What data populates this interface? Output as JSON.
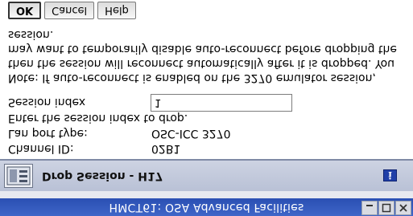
{
  "window": {
    "title": "HMCT61: OSA Advanced Facilities",
    "controls": [
      "minimize",
      "maximize",
      "close"
    ]
  },
  "dialog": {
    "title": "Drop Session - H17",
    "help_icon": "info-icon"
  },
  "fields": {
    "channel_id": {
      "label": "Channel ID:",
      "value": "02B1"
    },
    "lan_port_type": {
      "label": "Lan port type:",
      "value": "OSC-ICC 3270"
    },
    "instruction": "Enter the session index to drop.",
    "session_index": {
      "label": "Session index",
      "value": "1"
    }
  },
  "note": {
    "lines": [
      "Note: If auto-reconnect is enabled on the 3270 emulator session,",
      "then the session will reconnect automatically after it is dropped. You",
      "may want to temporarily disable auto-reconnect before dropping the",
      "session."
    ]
  },
  "buttons": {
    "ok": "OK",
    "cancel": "Cancel",
    "help": "Help"
  }
}
